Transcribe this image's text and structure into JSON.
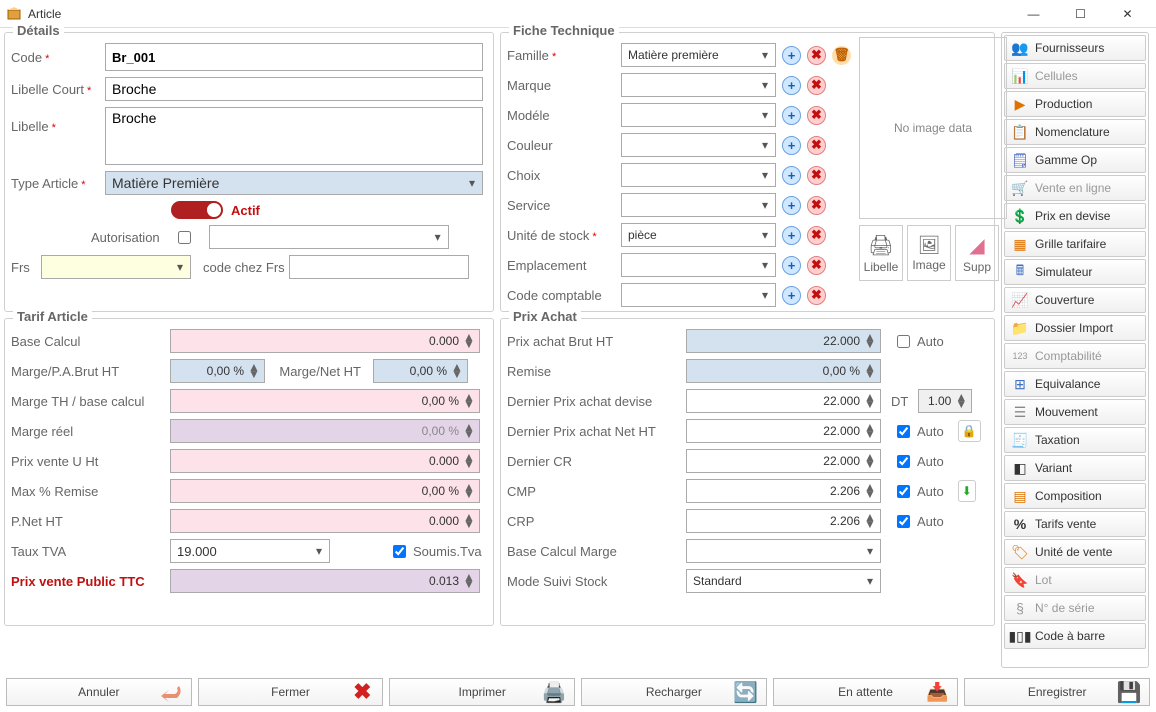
{
  "window": {
    "title": "Article"
  },
  "details": {
    "heading": "Détails",
    "code_label": "Code",
    "code": "Br_001",
    "libelle_court_label": "Libelle Court",
    "libelle_court": "Broche",
    "libelle_label": "Libelle",
    "libelle": "Broche",
    "type_article_label": "Type Article",
    "type_article": "Matière Première",
    "actif_label": "Actif",
    "autorisation_label": "Autorisation",
    "frs_label": "Frs",
    "code_chez_frs_label": "code chez Frs"
  },
  "fiche": {
    "heading": "Fiche Technique",
    "famille_label": "Famille",
    "famille": "Matière première",
    "marque_label": "Marque",
    "marque": "",
    "modele_label": "Modéle",
    "modele": "",
    "couleur_label": "Couleur",
    "couleur": "",
    "choix_label": "Choix",
    "choix": "",
    "service_label": "Service",
    "service": "",
    "unite_label": "Unité de stock",
    "unite": "pièce",
    "emplacement_label": "Emplacement",
    "emplacement": "",
    "code_comptable_label": "Code comptable",
    "code_comptable": "",
    "no_image": "No image data",
    "btn_libelle": "Libelle",
    "btn_image": "Image",
    "btn_supp": "Supp"
  },
  "tarif": {
    "heading": "Tarif Article",
    "base_calcul_label": "Base Calcul",
    "base_calcul": "0.000",
    "marge_pa_label": "Marge/P.A.Brut HT",
    "marge_pa": "0,00 %",
    "marge_net_label": "Marge/Net HT",
    "marge_net": "0,00 %",
    "marge_th_label": "Marge TH / base calcul",
    "marge_th": "0,00 %",
    "marge_reel_label": "Marge réel",
    "marge_reel": "0,00 %",
    "prix_vente_u_label": "Prix vente U Ht",
    "prix_vente_u": "0.000",
    "max_remise_label": "Max % Remise",
    "max_remise": "0,00 %",
    "pnet_label": "P.Net HT",
    "pnet": "0.000",
    "taux_tva_label": "Taux TVA",
    "taux_tva": "19.000",
    "soumis_tva_label": "Soumis.Tva",
    "prix_public_label": "Prix vente Public TTC",
    "prix_public": "0.013"
  },
  "prix_achat": {
    "heading": "Prix Achat",
    "brut_label": "Prix achat Brut HT",
    "brut": "22.000",
    "auto_label": "Auto",
    "remise_label": "Remise",
    "remise": "0,00 %",
    "dernier_devise_label": "Dernier Prix achat devise",
    "dernier_devise": "22.000",
    "dt_label": "DT",
    "dt": "1.00",
    "dernier_net_label": "Dernier Prix achat Net HT",
    "dernier_net": "22.000",
    "dernier_cr_label": "Dernier CR",
    "dernier_cr": "22.000",
    "cmp_label": "CMP",
    "cmp": "2.206",
    "crp_label": "CRP",
    "crp": "2.206",
    "base_marge_label": "Base Calcul Marge",
    "mode_suivi_label": "Mode Suivi Stock",
    "mode_suivi": "Standard"
  },
  "right": {
    "items": [
      {
        "label": "Fournisseurs",
        "icon": "👥",
        "color": "#1a8a1a"
      },
      {
        "label": "Cellules",
        "icon": "📊",
        "disabled": true
      },
      {
        "label": "Production",
        "icon": "▶",
        "color": "#e07000"
      },
      {
        "label": "Nomenclature",
        "icon": "📋",
        "color": "#c02020"
      },
      {
        "label": "Gamme Op",
        "icon": "🗒",
        "color": "#4060c0"
      },
      {
        "label": "Vente en ligne",
        "icon": "🛒",
        "disabled": true
      },
      {
        "label": "Prix en devise",
        "icon": "💲",
        "color": "#30a030"
      },
      {
        "label": "Grille tarifaire",
        "icon": "▦",
        "color": "#e07000"
      },
      {
        "label": "Simulateur",
        "icon": "🖩",
        "color": "#4070c0"
      },
      {
        "label": "Couverture",
        "icon": "📈",
        "color": "#30a030"
      },
      {
        "label": "Dossier Import",
        "icon": "📁",
        "color": "#e07000"
      },
      {
        "label": "Comptabilité",
        "icon": "123",
        "disabled": true,
        "small": true
      },
      {
        "label": "Equivalance",
        "icon": "⊞",
        "color": "#4070c0"
      },
      {
        "label": "Mouvement",
        "icon": "☰",
        "color": "#888"
      },
      {
        "label": "Taxation",
        "icon": "🧾",
        "color": "#30a030"
      },
      {
        "label": "Variant",
        "icon": "◧"
      },
      {
        "label": "Composition",
        "icon": "▤",
        "color": "#e07000"
      },
      {
        "label": "Tarifs vente",
        "icon": "%",
        "bold": true
      },
      {
        "label": "Unité de vente",
        "icon": "🏷",
        "color": "#e07000"
      },
      {
        "label": "Lot",
        "icon": "🔖",
        "disabled": true
      },
      {
        "label": "N° de série",
        "icon": "§",
        "disabled": true
      },
      {
        "label": "Code à barre",
        "icon": "▮▯▮"
      }
    ]
  },
  "bottom": {
    "annuler": "Annuler",
    "fermer": "Fermer",
    "imprimer": "Imprimer",
    "recharger": "Recharger",
    "en_attente": "En attente",
    "enregistrer": "Enregistrer"
  }
}
